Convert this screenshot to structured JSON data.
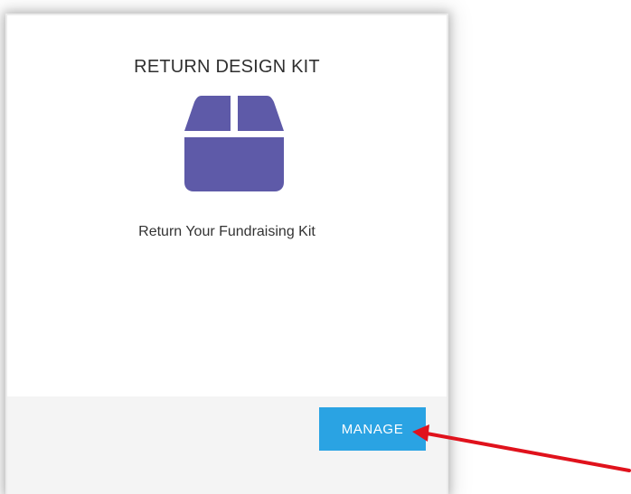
{
  "card": {
    "title": "RETURN DESIGN KIT",
    "subtitle": "Return Your Fundraising Kit",
    "icon": "box-icon",
    "icon_color": "#5e5aa8"
  },
  "actions": {
    "manage_label": "MANAGE",
    "button_color": "#2aa3e3"
  },
  "annotation": {
    "arrow_color": "#e0121c"
  }
}
